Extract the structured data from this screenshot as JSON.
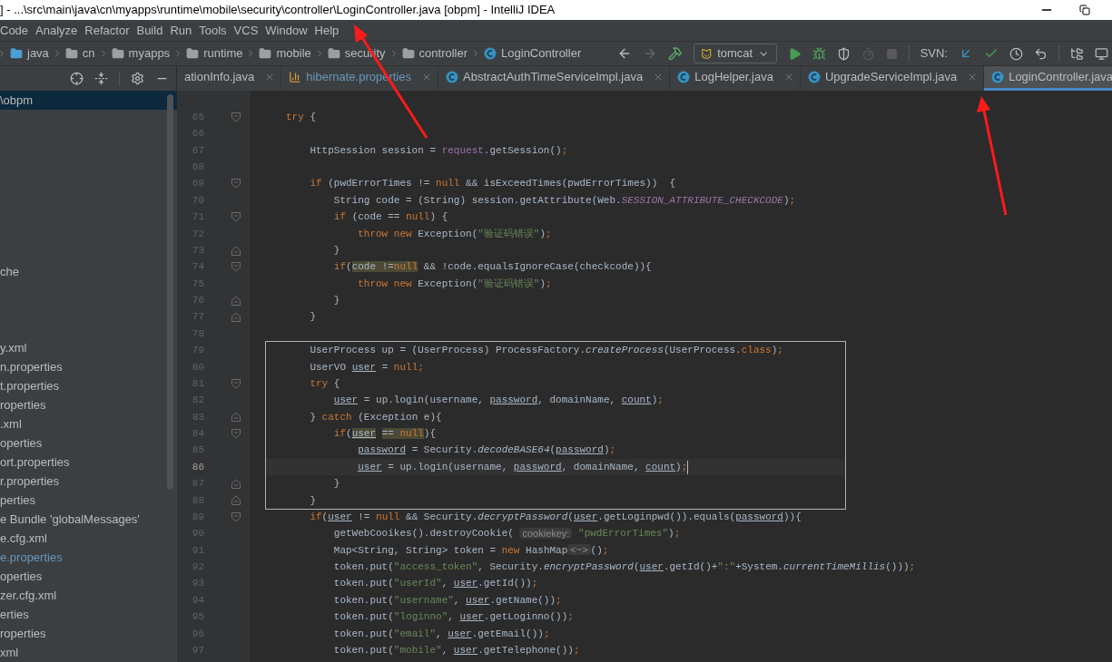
{
  "window": {
    "title": "] - ...\\src\\main\\java\\cn\\myapps\\runtime\\mobile\\security\\controller\\LoginController.java [obpm] - IntelliJ IDEA"
  },
  "menu": [
    "Code",
    "Analyze",
    "Refactor",
    "Build",
    "Run",
    "Tools",
    "VCS",
    "Window",
    "Help"
  ],
  "breadcrumbs": [
    "java",
    "cn",
    "myapps",
    "runtime",
    "mobile",
    "security",
    "controller",
    "LoginController"
  ],
  "toolbar": {
    "run_config": "tomcat",
    "svn_label": "SVN:"
  },
  "tabs": [
    {
      "label": "ationInfo.java",
      "selected": false
    },
    {
      "label": "hibernate.properties",
      "selected": false
    },
    {
      "label": "AbstractAuthTimeServiceImpl.java",
      "selected": false
    },
    {
      "label": "LogHelper.java",
      "selected": false
    },
    {
      "label": "UpgradeServiceImpl.java",
      "selected": false
    },
    {
      "label": "LoginController.java",
      "selected": true
    }
  ],
  "project_tree": [
    {
      "kind": "file",
      "label": "\\obpm",
      "selected": true,
      "modified": false
    },
    {
      "kind": "blank"
    },
    {
      "kind": "blank"
    },
    {
      "kind": "blank"
    },
    {
      "kind": "blank"
    },
    {
      "kind": "blank"
    },
    {
      "kind": "blank"
    },
    {
      "kind": "blank"
    },
    {
      "kind": "blank"
    },
    {
      "kind": "file",
      "label": "che",
      "selected": false,
      "modified": false
    },
    {
      "kind": "blank"
    },
    {
      "kind": "blank"
    },
    {
      "kind": "blank"
    },
    {
      "kind": "file",
      "label": "y.xml",
      "selected": false,
      "modified": false
    },
    {
      "kind": "file",
      "label": "n.properties",
      "selected": false,
      "modified": false
    },
    {
      "kind": "file",
      "label": "t.properties",
      "selected": false,
      "modified": false
    },
    {
      "kind": "file",
      "label": "roperties",
      "selected": false,
      "modified": false
    },
    {
      "kind": "file",
      "label": ".xml",
      "selected": false,
      "modified": false
    },
    {
      "kind": "file",
      "label": "operties",
      "selected": false,
      "modified": false
    },
    {
      "kind": "file",
      "label": "ort.properties",
      "selected": false,
      "modified": false
    },
    {
      "kind": "file",
      "label": "r.properties",
      "selected": false,
      "modified": false
    },
    {
      "kind": "file",
      "label": "perties",
      "selected": false,
      "modified": false
    },
    {
      "kind": "file",
      "label": "e Bundle 'globalMessages'",
      "selected": false,
      "modified": false
    },
    {
      "kind": "file",
      "label": "e.cfg.xml",
      "selected": false,
      "modified": false
    },
    {
      "kind": "file",
      "label": "e.properties",
      "selected": false,
      "modified": true
    },
    {
      "kind": "file",
      "label": "operties",
      "selected": false,
      "modified": false
    },
    {
      "kind": "file",
      "label": "zer.cfg.xml",
      "selected": false,
      "modified": false
    },
    {
      "kind": "file",
      "label": "erties",
      "selected": false,
      "modified": false
    },
    {
      "kind": "file",
      "label": "roperties",
      "selected": false,
      "modified": false
    },
    {
      "kind": "file",
      "label": "xml",
      "selected": false,
      "modified": false
    }
  ],
  "editor": {
    "lines": [
      {
        "number": "65",
        "fold_start": true,
        "fold_end": false,
        "boxed": false,
        "current": false,
        "tokens": [
          {
            "kind": "keyword",
            "text": "try"
          },
          {
            "kind": "plain",
            "text": " {"
          }
        ]
      },
      {
        "number": "66",
        "fold_start": false,
        "fold_end": false
      },
      {
        "number": "67",
        "fold_start": false,
        "fold_end": false,
        "boxed": false,
        "current": false,
        "tokens": [
          {
            "kind": "plain",
            "text": "    HttpSession session = "
          },
          {
            "kind": "field",
            "text": "request"
          },
          {
            "kind": "plain",
            "text": ".getSession()"
          },
          {
            "kind": "keyword",
            "text": ";"
          }
        ]
      },
      {
        "number": "68",
        "fold_start": false,
        "fold_end": false
      },
      {
        "number": "69",
        "fold_start": true,
        "fold_end": false,
        "boxed": false,
        "current": false,
        "tokens": [
          {
            "kind": "keyword",
            "text": "    if"
          },
          {
            "kind": "plain",
            "text": " (pwdErrorTimes != "
          },
          {
            "kind": "keyword",
            "text": "null"
          },
          {
            "kind": "plain",
            "text": " && isExceedTimes(pwdErrorTimes))  {"
          }
        ]
      },
      {
        "number": "70",
        "fold_start": false,
        "fold_end": false,
        "boxed": false,
        "current": false,
        "tokens": [
          {
            "kind": "plain",
            "text": "        String code = (String) session.getAttribute(Web."
          },
          {
            "kind": "constant",
            "text": "SESSION_ATTRIBUTE_CHECKCODE"
          },
          {
            "kind": "plain",
            "text": ")"
          },
          {
            "kind": "keyword",
            "text": ";"
          }
        ]
      },
      {
        "number": "71",
        "fold_start": true,
        "fold_end": false,
        "boxed": false,
        "current": false,
        "tokens": [
          {
            "kind": "keyword",
            "text": "        if"
          },
          {
            "kind": "plain",
            "text": " (code == "
          },
          {
            "kind": "keyword",
            "text": "null"
          },
          {
            "kind": "plain",
            "text": ") {"
          }
        ]
      },
      {
        "number": "72",
        "fold_start": false,
        "fold_end": false,
        "boxed": false,
        "current": false,
        "tokens": [
          {
            "kind": "keyword",
            "text": "            throw new"
          },
          {
            "kind": "plain",
            "text": " Exception("
          },
          {
            "kind": "string",
            "text": "\"验证码错误\""
          },
          {
            "kind": "plain",
            "text": ")"
          },
          {
            "kind": "keyword",
            "text": ";"
          }
        ]
      },
      {
        "number": "73",
        "fold_start": false,
        "fold_end": true,
        "boxed": false,
        "current": false,
        "tokens": [
          {
            "kind": "plain",
            "text": "        }"
          }
        ]
      },
      {
        "number": "74",
        "fold_start": true,
        "fold_end": false,
        "boxed": false,
        "current": false,
        "tokens": [
          {
            "kind": "keyword",
            "text": "        if"
          },
          {
            "kind": "plain",
            "text": "("
          },
          {
            "kind": "highlight",
            "text": "code !="
          },
          {
            "kind": "highlight_keyword",
            "text": "null"
          },
          {
            "kind": "plain",
            "text": " && !code.equalsIgnoreCase(checkcode)){"
          }
        ]
      },
      {
        "number": "75",
        "fold_start": false,
        "fold_end": false,
        "boxed": false,
        "current": false,
        "tokens": [
          {
            "kind": "keyword",
            "text": "            throw new"
          },
          {
            "kind": "plain",
            "text": " Exception("
          },
          {
            "kind": "string",
            "text": "\"验证码错误\""
          },
          {
            "kind": "plain",
            "text": ")"
          },
          {
            "kind": "keyword",
            "text": ";"
          }
        ]
      },
      {
        "number": "76",
        "fold_start": false,
        "fold_end": true,
        "boxed": false,
        "current": false,
        "tokens": [
          {
            "kind": "plain",
            "text": "        }"
          }
        ]
      },
      {
        "number": "77",
        "fold_start": false,
        "fold_end": true,
        "boxed": false,
        "current": false,
        "tokens": [
          {
            "kind": "plain",
            "text": "    }"
          }
        ]
      },
      {
        "number": "78",
        "fold_start": false,
        "fold_end": false
      },
      {
        "number": "79",
        "fold_start": false,
        "fold_end": false,
        "boxed": true,
        "current": false,
        "tokens": [
          {
            "kind": "plain",
            "text": "    UserProcess up = (UserProcess) ProcessFactory."
          },
          {
            "kind": "static",
            "text": "createProcess"
          },
          {
            "kind": "plain",
            "text": "(UserProcess."
          },
          {
            "kind": "keyword",
            "text": "class"
          },
          {
            "kind": "plain",
            "text": ")"
          },
          {
            "kind": "keyword",
            "text": ";"
          }
        ]
      },
      {
        "number": "80",
        "fold_start": false,
        "fold_end": false,
        "boxed": true,
        "current": false,
        "tokens": [
          {
            "kind": "plain",
            "text": "    UserVO "
          },
          {
            "kind": "variable",
            "text": "user"
          },
          {
            "kind": "plain",
            "text": " = "
          },
          {
            "kind": "keyword",
            "text": "null;"
          }
        ]
      },
      {
        "number": "81",
        "fold_start": true,
        "fold_end": false,
        "boxed": true,
        "current": false,
        "tokens": [
          {
            "kind": "keyword",
            "text": "    try"
          },
          {
            "kind": "plain",
            "text": " {"
          }
        ]
      },
      {
        "number": "82",
        "fold_start": false,
        "fold_end": false,
        "boxed": true,
        "current": false,
        "tokens": [
          {
            "kind": "variable",
            "text": "        user"
          },
          {
            "kind": "plain",
            "text": " = up.login(username, "
          },
          {
            "kind": "variable",
            "text": "password"
          },
          {
            "kind": "plain",
            "text": ", domainName, "
          },
          {
            "kind": "variable",
            "text": "count"
          },
          {
            "kind": "plain",
            "text": ")"
          },
          {
            "kind": "keyword",
            "text": ";"
          }
        ]
      },
      {
        "number": "83",
        "fold_start": false,
        "fold_end": true,
        "boxed": true,
        "current": false,
        "tokens": [
          {
            "kind": "plain",
            "text": "    } "
          },
          {
            "kind": "keyword",
            "text": "catch"
          },
          {
            "kind": "plain",
            "text": " (Exception e){"
          }
        ]
      },
      {
        "number": "84",
        "fold_start": true,
        "fold_end": false,
        "boxed": true,
        "current": false,
        "tokens": [
          {
            "kind": "keyword",
            "text": "        if"
          },
          {
            "kind": "plain",
            "text": "("
          },
          {
            "kind": "highlight_variable",
            "text": "user"
          },
          {
            "kind": "highlight",
            "text": " == "
          },
          {
            "kind": "highlight_keyword",
            "text": "null"
          },
          {
            "kind": "plain",
            "text": "){"
          }
        ]
      },
      {
        "number": "85",
        "fold_start": false,
        "fold_end": false,
        "boxed": true,
        "current": false,
        "tokens": [
          {
            "kind": "variable",
            "text": "            password"
          },
          {
            "kind": "plain",
            "text": " = Security."
          },
          {
            "kind": "static",
            "text": "decodeBASE64"
          },
          {
            "kind": "plain",
            "text": "("
          },
          {
            "kind": "variable",
            "text": "password"
          },
          {
            "kind": "plain",
            "text": ")"
          },
          {
            "kind": "keyword",
            "text": ";"
          }
        ]
      },
      {
        "number": "86",
        "fold_start": false,
        "fold_end": false,
        "boxed": true,
        "current": true,
        "tokens": [
          {
            "kind": "variable",
            "text": "            user"
          },
          {
            "kind": "plain",
            "text": " = up.login(username, "
          },
          {
            "kind": "variable",
            "text": "password"
          },
          {
            "kind": "plain",
            "text": ", domainName, "
          },
          {
            "kind": "variable",
            "text": "count"
          },
          {
            "kind": "plain",
            "text": ")"
          },
          {
            "kind": "keyword",
            "text": ";"
          }
        ]
      },
      {
        "number": "87",
        "fold_start": false,
        "fold_end": true,
        "boxed": true,
        "current": false,
        "tokens": [
          {
            "kind": "plain",
            "text": "        }"
          }
        ]
      },
      {
        "number": "88",
        "fold_start": false,
        "fold_end": true,
        "boxed": true,
        "current": false,
        "tokens": [
          {
            "kind": "plain",
            "text": "    }"
          }
        ]
      },
      {
        "number": "89",
        "fold_start": true,
        "fold_end": false,
        "boxed": false,
        "current": false,
        "tokens": [
          {
            "kind": "keyword",
            "text": "    if"
          },
          {
            "kind": "plain",
            "text": "("
          },
          {
            "kind": "variable",
            "text": "user"
          },
          {
            "kind": "plain",
            "text": " != "
          },
          {
            "kind": "keyword",
            "text": "null"
          },
          {
            "kind": "plain",
            "text": " && Security."
          },
          {
            "kind": "static",
            "text": "decryptPassword"
          },
          {
            "kind": "plain",
            "text": "("
          },
          {
            "kind": "variable",
            "text": "user"
          },
          {
            "kind": "plain",
            "text": ".getLoginpwd()).equals("
          },
          {
            "kind": "variable",
            "text": "password"
          },
          {
            "kind": "plain",
            "text": ")){"
          }
        ]
      },
      {
        "number": "90",
        "fold_start": false,
        "fold_end": false,
        "boxed": false,
        "current": false,
        "tokens": [
          {
            "kind": "plain",
            "text": "        getWebCooikes().destroyCookie( "
          },
          {
            "kind": "hint",
            "text": "cookiekey:"
          },
          {
            "kind": "string",
            "text": " \"pwdErrorTimes\""
          },
          {
            "kind": "plain",
            "text": ")"
          },
          {
            "kind": "keyword",
            "text": ";"
          }
        ]
      },
      {
        "number": "91",
        "fold_start": false,
        "fold_end": false,
        "boxed": false,
        "current": false,
        "tokens": [
          {
            "kind": "plain",
            "text": "        Map<String, String> token = "
          },
          {
            "kind": "keyword",
            "text": "new"
          },
          {
            "kind": "plain",
            "text": " HashMap"
          },
          {
            "kind": "hint",
            "text": "<~>"
          },
          {
            "kind": "plain",
            "text": "()"
          },
          {
            "kind": "keyword",
            "text": ";"
          }
        ]
      },
      {
        "number": "92",
        "fold_start": false,
        "fold_end": false,
        "boxed": false,
        "current": false,
        "tokens": [
          {
            "kind": "plain",
            "text": "        token.put("
          },
          {
            "kind": "string",
            "text": "\"access_token\""
          },
          {
            "kind": "plain",
            "text": ", Security."
          },
          {
            "kind": "static",
            "text": "encryptPassword"
          },
          {
            "kind": "plain",
            "text": "("
          },
          {
            "kind": "variable",
            "text": "user"
          },
          {
            "kind": "plain",
            "text": ".getId()+"
          },
          {
            "kind": "string",
            "text": "\":\""
          },
          {
            "kind": "plain",
            "text": "+System."
          },
          {
            "kind": "static",
            "text": "currentTimeMillis"
          },
          {
            "kind": "plain",
            "text": "()))"
          },
          {
            "kind": "keyword",
            "text": ";"
          }
        ]
      },
      {
        "number": "93",
        "fold_start": false,
        "fold_end": false,
        "boxed": false,
        "current": false,
        "tokens": [
          {
            "kind": "plain",
            "text": "        token.put("
          },
          {
            "kind": "string",
            "text": "\"userId\""
          },
          {
            "kind": "plain",
            "text": ", "
          },
          {
            "kind": "variable",
            "text": "user"
          },
          {
            "kind": "plain",
            "text": ".getId())"
          },
          {
            "kind": "keyword",
            "text": ";"
          }
        ]
      },
      {
        "number": "94",
        "fold_start": false,
        "fold_end": false,
        "boxed": false,
        "current": false,
        "tokens": [
          {
            "kind": "plain",
            "text": "        token.put("
          },
          {
            "kind": "string",
            "text": "\"username\""
          },
          {
            "kind": "plain",
            "text": ", "
          },
          {
            "kind": "variable",
            "text": "user"
          },
          {
            "kind": "plain",
            "text": ".getName())"
          },
          {
            "kind": "keyword",
            "text": ";"
          }
        ]
      },
      {
        "number": "95",
        "fold_start": false,
        "fold_end": false,
        "boxed": false,
        "current": false,
        "tokens": [
          {
            "kind": "plain",
            "text": "        token.put("
          },
          {
            "kind": "string",
            "text": "\"loginno\""
          },
          {
            "kind": "plain",
            "text": ", "
          },
          {
            "kind": "variable",
            "text": "user"
          },
          {
            "kind": "plain",
            "text": ".getLoginno())"
          },
          {
            "kind": "keyword",
            "text": ";"
          }
        ]
      },
      {
        "number": "96",
        "fold_start": false,
        "fold_end": false,
        "boxed": false,
        "current": false,
        "tokens": [
          {
            "kind": "plain",
            "text": "        token.put("
          },
          {
            "kind": "string",
            "text": "\"email\""
          },
          {
            "kind": "plain",
            "text": ", "
          },
          {
            "kind": "variable",
            "text": "user"
          },
          {
            "kind": "plain",
            "text": ".getEmail())"
          },
          {
            "kind": "keyword",
            "text": ";"
          }
        ]
      },
      {
        "number": "97",
        "fold_start": false,
        "fold_end": false,
        "boxed": false,
        "current": false,
        "tokens": [
          {
            "kind": "plain",
            "text": "        token.put("
          },
          {
            "kind": "string",
            "text": "\"mobile\""
          },
          {
            "kind": "plain",
            "text": ", "
          },
          {
            "kind": "variable",
            "text": "user"
          },
          {
            "kind": "plain",
            "text": ".getTelephone())"
          },
          {
            "kind": "keyword",
            "text": ";"
          }
        ]
      }
    ]
  }
}
